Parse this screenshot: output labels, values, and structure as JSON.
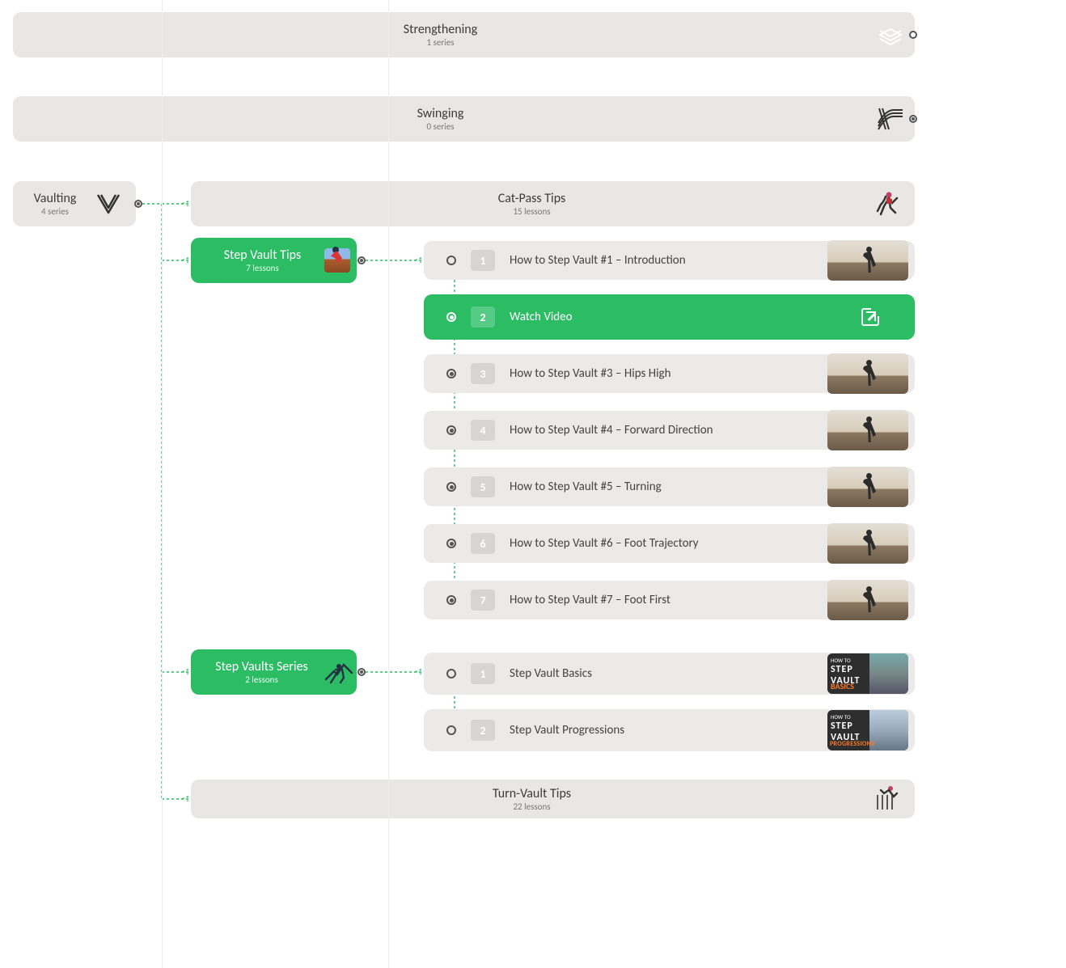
{
  "categories": {
    "strengthening": {
      "title": "Strengthening",
      "sub": "1 series"
    },
    "swinging": {
      "title": "Swinging",
      "sub": "0 series"
    },
    "vaulting": {
      "title": "Vaulting",
      "sub": "4 series"
    }
  },
  "series": {
    "catpass": {
      "title": "Cat-Pass Tips",
      "sub": "15 lessons"
    },
    "stepvault_tips": {
      "title": "Step Vault Tips",
      "sub": "7 lessons"
    },
    "stepvault_series": {
      "title": "Step Vaults Series",
      "sub": "2 lessons"
    },
    "turnvault": {
      "title": "Turn-Vault Tips",
      "sub": "22 lessons"
    }
  },
  "lessons_tips": [
    {
      "num": "1",
      "label": "How to Step Vault #1 – Introduction"
    },
    {
      "num": "2",
      "label": "Watch Video"
    },
    {
      "num": "3",
      "label": "How to Step Vault #3 – Hips High"
    },
    {
      "num": "4",
      "label": "How to Step Vault #4 – Forward Direction"
    },
    {
      "num": "5",
      "label": "How to Step Vault #5 – Turning"
    },
    {
      "num": "6",
      "label": "How to Step Vault #6 – Foot Trajectory"
    },
    {
      "num": "7",
      "label": "How to Step Vault #7 – Foot First"
    }
  ],
  "lessons_series": [
    {
      "num": "1",
      "label": "Step Vault Basics"
    },
    {
      "num": "2",
      "label": "Step Vault Progressions"
    }
  ],
  "thumb_text": {
    "howto": "HOW TO",
    "step": "STEP",
    "vault": "VAULT",
    "basics": "BASICS",
    "progressions": "PROGRESSIONS"
  },
  "colors": {
    "green": "#2cbc63",
    "grey": "#e8e7e5",
    "dark": "#3c3c3c"
  }
}
